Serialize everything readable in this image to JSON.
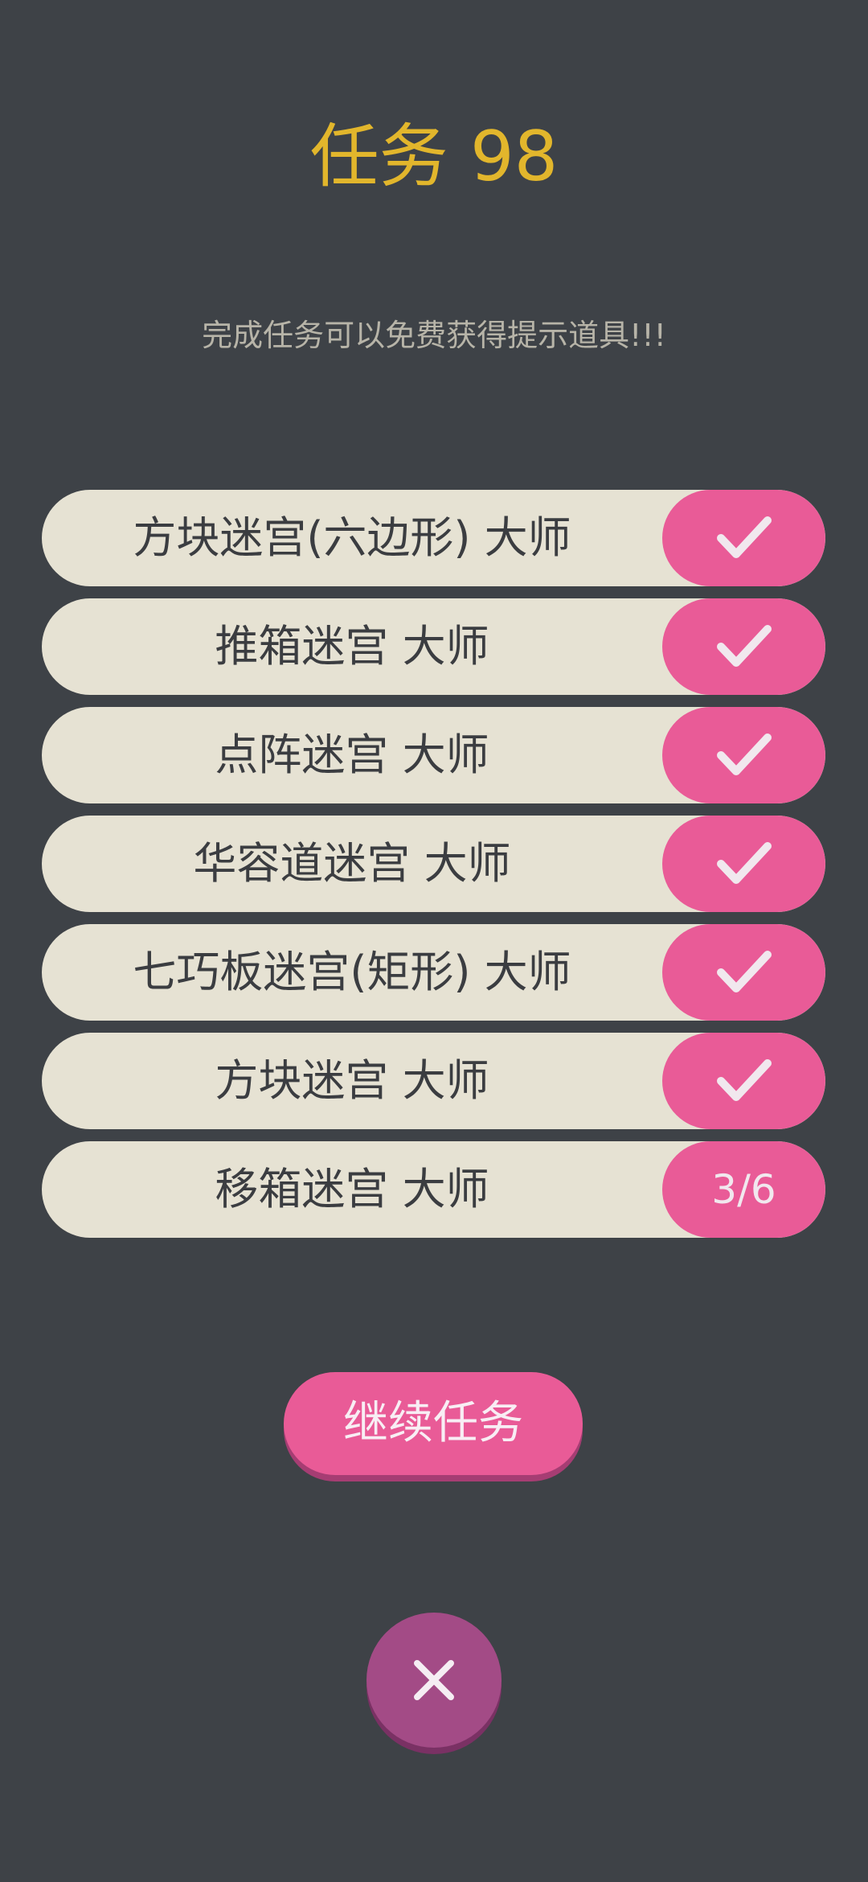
{
  "header": {
    "title": "任务 98",
    "subtitle": "完成任务可以免费获得提示道具!!!"
  },
  "tasks": [
    {
      "label": "方块迷宫(六边形) 大师",
      "status": "check-icon",
      "progress_text": ""
    },
    {
      "label": "推箱迷宫 大师",
      "status": "check-icon",
      "progress_text": ""
    },
    {
      "label": "点阵迷宫 大师",
      "status": "check-icon",
      "progress_text": ""
    },
    {
      "label": "华容道迷宫 大师",
      "status": "check-icon",
      "progress_text": ""
    },
    {
      "label": "七巧板迷宫(矩形) 大师",
      "status": "check-icon",
      "progress_text": ""
    },
    {
      "label": "方块迷宫 大师",
      "status": "check-icon",
      "progress_text": ""
    },
    {
      "label": "移箱迷宫 大师",
      "status": "progress",
      "progress_text": "3/6"
    }
  ],
  "actions": {
    "continue_label": "继续任务",
    "close_icon": "close-icon"
  },
  "colors": {
    "background": "#3e4247",
    "title": "#e2b62c",
    "subtitle": "#b7b4a8",
    "row": "#e6e2d3",
    "accent": "#e95b97",
    "close": "#a34b86"
  }
}
